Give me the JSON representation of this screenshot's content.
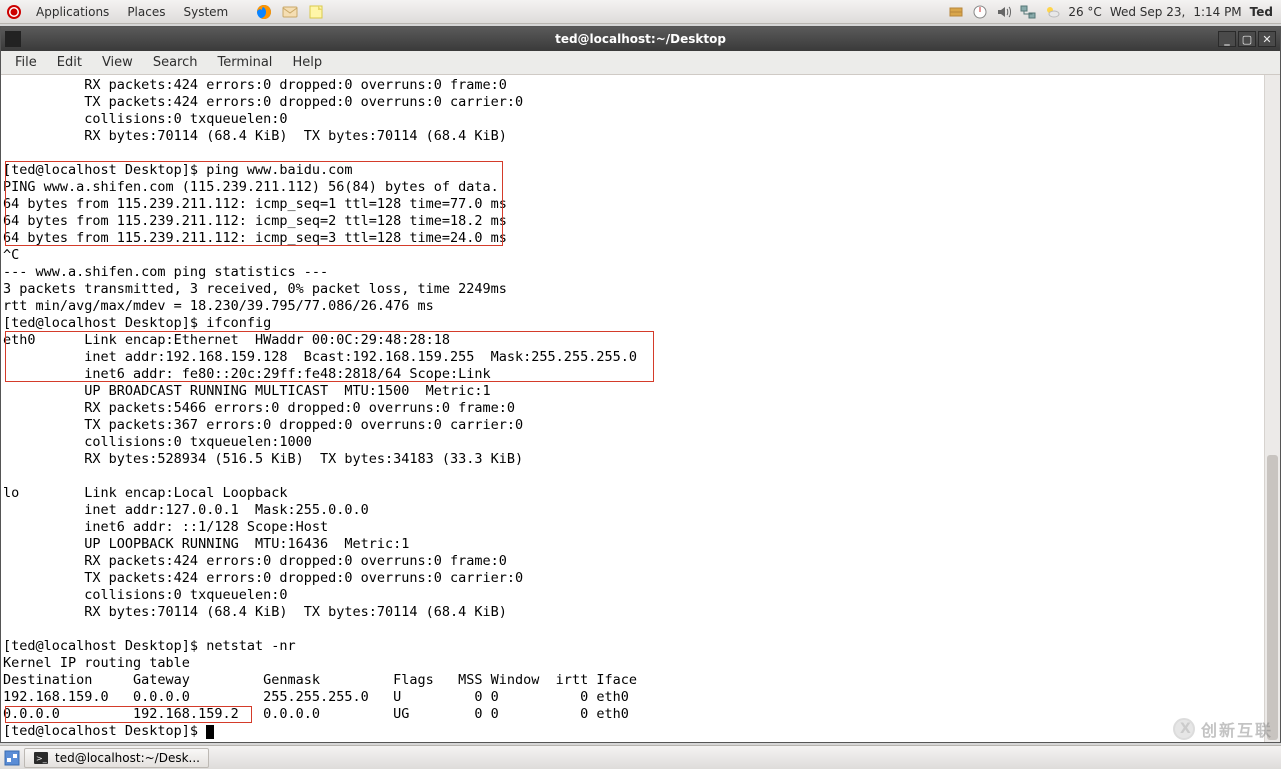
{
  "panel": {
    "menus": [
      "Applications",
      "Places",
      "System"
    ],
    "temp": "26 °C",
    "date": "Wed Sep 23,",
    "time": "1:14 PM",
    "username": "Ted"
  },
  "window": {
    "title": "ted@localhost:~/Desktop",
    "menus": [
      "File",
      "Edit",
      "View",
      "Search",
      "Terminal",
      "Help"
    ]
  },
  "terminal": {
    "lines": [
      "          RX packets:424 errors:0 dropped:0 overruns:0 frame:0",
      "          TX packets:424 errors:0 dropped:0 overruns:0 carrier:0",
      "          collisions:0 txqueuelen:0",
      "          RX bytes:70114 (68.4 KiB)  TX bytes:70114 (68.4 KiB)",
      "",
      "[ted@localhost Desktop]$ ping www.baidu.com",
      "PING www.a.shifen.com (115.239.211.112) 56(84) bytes of data.",
      "64 bytes from 115.239.211.112: icmp_seq=1 ttl=128 time=77.0 ms",
      "64 bytes from 115.239.211.112: icmp_seq=2 ttl=128 time=18.2 ms",
      "64 bytes from 115.239.211.112: icmp_seq=3 ttl=128 time=24.0 ms",
      "^C",
      "--- www.a.shifen.com ping statistics ---",
      "3 packets transmitted, 3 received, 0% packet loss, time 2249ms",
      "rtt min/avg/max/mdev = 18.230/39.795/77.086/26.476 ms",
      "[ted@localhost Desktop]$ ifconfig",
      "eth0      Link encap:Ethernet  HWaddr 00:0C:29:48:28:18",
      "          inet addr:192.168.159.128  Bcast:192.168.159.255  Mask:255.255.255.0",
      "          inet6 addr: fe80::20c:29ff:fe48:2818/64 Scope:Link",
      "          UP BROADCAST RUNNING MULTICAST  MTU:1500  Metric:1",
      "          RX packets:5466 errors:0 dropped:0 overruns:0 frame:0",
      "          TX packets:367 errors:0 dropped:0 overruns:0 carrier:0",
      "          collisions:0 txqueuelen:1000",
      "          RX bytes:528934 (516.5 KiB)  TX bytes:34183 (33.3 KiB)",
      "",
      "lo        Link encap:Local Loopback",
      "          inet addr:127.0.0.1  Mask:255.0.0.0",
      "          inet6 addr: ::1/128 Scope:Host",
      "          UP LOOPBACK RUNNING  MTU:16436  Metric:1",
      "          RX packets:424 errors:0 dropped:0 overruns:0 frame:0",
      "          TX packets:424 errors:0 dropped:0 overruns:0 carrier:0",
      "          collisions:0 txqueuelen:0",
      "          RX bytes:70114 (68.4 KiB)  TX bytes:70114 (68.4 KiB)",
      "",
      "[ted@localhost Desktop]$ netstat -nr",
      "Kernel IP routing table",
      "Destination     Gateway         Genmask         Flags   MSS Window  irtt Iface",
      "192.168.159.0   0.0.0.0         255.255.255.0   U         0 0          0 eth0",
      "0.0.0.0         192.168.159.2   0.0.0.0         UG        0 0          0 eth0"
    ],
    "prompt": "[ted@localhost Desktop]$ "
  },
  "taskbar": {
    "task": "ted@localhost:~/Desk..."
  },
  "watermark": "创新互联"
}
